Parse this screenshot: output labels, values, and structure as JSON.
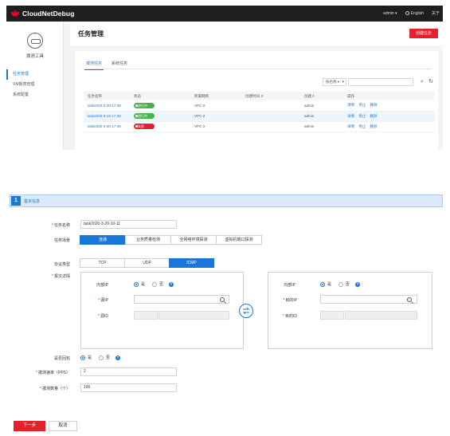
{
  "app": {
    "brand": "CloudNetDebug",
    "user_menu": "admin ▾",
    "language": "English",
    "language_extra": "关于",
    "sidebar": {
      "title": "拨测工具",
      "items": [
        "任务管理",
        "VM报表管理",
        "系统配置"
      ]
    },
    "page": {
      "title": "任务管理",
      "subtitle": "",
      "create_button": "创建任务",
      "tabs": [
        "拨测任务",
        "系统任务"
      ],
      "filter_select": "按名称 ▾",
      "filter_placeholder": "",
      "columns": [
        "任务名称",
        "状态",
        "所属网络",
        "创建时间 ⇕",
        "创建人",
        "操作"
      ],
      "rows": [
        {
          "name": "task2020-3-20-17-38",
          "status": "进行中",
          "status_color": "green",
          "network": "VPC-2",
          "created": "",
          "creator": "admin",
          "ops": [
            "详情",
            "停止",
            "删除"
          ]
        },
        {
          "name": "task2020-3-19-17-38",
          "status": "进行中",
          "status_color": "green",
          "network": "VPC-2",
          "created": "",
          "creator": "admin",
          "ops": [
            "详情",
            "停止",
            "删除"
          ]
        },
        {
          "name": "task2020-3-20-17-38",
          "status": "失败",
          "status_color": "red",
          "network": "VPC-2",
          "created": "",
          "creator": "admin",
          "ops": [
            "详情",
            "停止",
            "删除"
          ]
        }
      ]
    }
  },
  "form": {
    "section_number": "1",
    "section_title": "基本信息",
    "task_name_label": "任务名称",
    "task_name_value": "task2020-3-20-10-11",
    "scenario_label": "任务场景",
    "scenarios": [
      "连通",
      "业务质量检测",
      "全网络环境探测",
      "虚拟机端口探测"
    ],
    "scenario_hint": "",
    "protocol_label": "协议类型",
    "protocols": [
      "TCP",
      "UDP",
      "ICMP"
    ],
    "packet_label": "报文详情",
    "inner_ip_label": "内部IP",
    "yes": "是",
    "no": "否",
    "source_ip_label": "源IP",
    "source_id_label": "源ID",
    "dest_ip_label": "目的IP",
    "dest_id_label": "目的ID",
    "return_label": "是否回包",
    "rate_label": "拨测速率（PPS）",
    "rate_value": "2",
    "count_label": "拨测数量（个）",
    "count_value": "100",
    "note": "",
    "next_button": "下一步",
    "cancel_button": "取消",
    "accent": "#1a77d8",
    "danger": "#e4202b"
  }
}
